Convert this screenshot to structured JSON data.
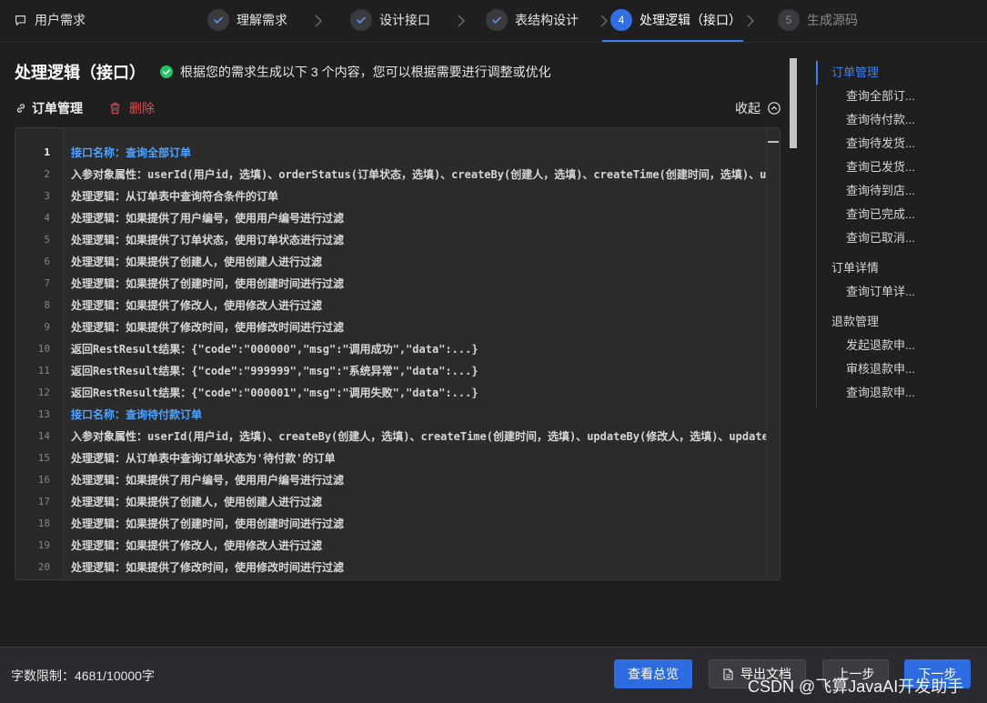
{
  "app": {
    "title": "用户需求",
    "icon": "chat-bubble-icon"
  },
  "stepper": {
    "steps": [
      {
        "label": "理解需求",
        "icon": "check-icon"
      },
      {
        "label": "设计接口",
        "icon": "check-icon"
      },
      {
        "label": "表结构设计",
        "icon": "check-icon"
      },
      {
        "index": "4",
        "label": "处理逻辑（接口）",
        "active": true
      },
      {
        "index": "5",
        "label": "生成源码"
      }
    ]
  },
  "header": {
    "title": "处理逻辑（接口）",
    "status_icon": "check-circle-icon",
    "message": "根据您的需求生成以下 3 个内容，您可以根据需要进行调整或优化"
  },
  "section": {
    "icon": "link-icon",
    "name": "订单管理",
    "delete_icon": "trash-icon",
    "delete_label": "删除",
    "collapse_label": "收起",
    "collapse_icon": "chevron-up-circle-icon"
  },
  "editor": {
    "current_line": 1,
    "lines": [
      {
        "n": 1,
        "text": "接口名称：查询全部订单",
        "heading": true
      },
      {
        "n": 2,
        "text": "入参对象属性：userId(用户id，选填)、orderStatus(订单状态，选填)、createBy(创建人，选填)、createTime(创建时间，选填)、up"
      },
      {
        "n": 3,
        "text": "处理逻辑：从订单表中查询符合条件的订单"
      },
      {
        "n": 4,
        "text": "处理逻辑：如果提供了用户编号，使用用户编号进行过滤"
      },
      {
        "n": 5,
        "text": "处理逻辑：如果提供了订单状态，使用订单状态进行过滤"
      },
      {
        "n": 6,
        "text": "处理逻辑：如果提供了创建人，使用创建人进行过滤"
      },
      {
        "n": 7,
        "text": "处理逻辑：如果提供了创建时间，使用创建时间进行过滤"
      },
      {
        "n": 8,
        "text": "处理逻辑：如果提供了修改人，使用修改人进行过滤"
      },
      {
        "n": 9,
        "text": "处理逻辑：如果提供了修改时间，使用修改时间进行过滤"
      },
      {
        "n": 10,
        "text": "返回RestResult结果：{\"code\":\"000000\",\"msg\":\"调用成功\",\"data\":...}"
      },
      {
        "n": 11,
        "text": "返回RestResult结果：{\"code\":\"999999\",\"msg\":\"系统异常\",\"data\":...}"
      },
      {
        "n": 12,
        "text": "返回RestResult结果：{\"code\":\"000001\",\"msg\":\"调用失败\",\"data\":...}"
      },
      {
        "n": 13,
        "text": "接口名称：查询待付款订单",
        "heading": true
      },
      {
        "n": 14,
        "text": "入参对象属性：userId(用户id，选填)、createBy(创建人，选填)、createTime(创建时间，选填)、updateBy(修改人，选填)、updateT"
      },
      {
        "n": 15,
        "text": "处理逻辑：从订单表中查询订单状态为'待付款'的订单"
      },
      {
        "n": 16,
        "text": "处理逻辑：如果提供了用户编号，使用用户编号进行过滤"
      },
      {
        "n": 17,
        "text": "处理逻辑：如果提供了创建人，使用创建人进行过滤"
      },
      {
        "n": 18,
        "text": "处理逻辑：如果提供了创建时间，使用创建时间进行过滤"
      },
      {
        "n": 19,
        "text": "处理逻辑：如果提供了修改人，使用修改人进行过滤"
      },
      {
        "n": 20,
        "text": "处理逻辑：如果提供了修改时间，使用修改时间进行过滤"
      }
    ]
  },
  "outline": {
    "groups": [
      {
        "label": "订单管理",
        "active": true,
        "items": [
          "查询全部订...",
          "查询待付款...",
          "查询待发货...",
          "查询已发货...",
          "查询待到店...",
          "查询已完成...",
          "查询已取消..."
        ]
      },
      {
        "label": "订单详情",
        "items": [
          "查询订单详..."
        ]
      },
      {
        "label": "退款管理",
        "items": [
          "发起退款申...",
          "审核退款申...",
          "查询退款申..."
        ]
      }
    ]
  },
  "footer": {
    "limit_label": "字数限制：",
    "limit_value": "4681/10000字",
    "buttons": {
      "overview": "查看总览",
      "export": "导出文档",
      "export_icon": "document-icon",
      "prev": "上一步",
      "next": "下一步"
    }
  },
  "watermark": "CSDN @飞算JavaAI开发助手",
  "colors": {
    "accent": "#2f6fe4",
    "heading": "#4da3ff",
    "success": "#22c55e",
    "danger": "#e5484d",
    "background": "#1f1f20",
    "editor_background": "#2b2b2b"
  }
}
